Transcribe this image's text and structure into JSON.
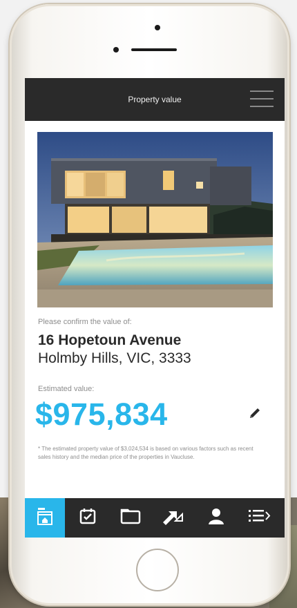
{
  "header": {
    "title": "Property value"
  },
  "hero": {
    "image_desc": "modern-house-with-pool-photo"
  },
  "property": {
    "confirm_prompt": "Please confirm the value of:",
    "street": "16 Hopetoun Avenue",
    "suburb_line": "Holmby Hills, VIC, 3333",
    "estimated_label": "Estimated value:",
    "value": "$975,834",
    "disclaimer": "* The estimated property value of $3,024,534 is based on various factors such as recent sales history and the median price of the properties in Vaucluse."
  },
  "tabs": [
    {
      "icon": "home-icon",
      "active": true
    },
    {
      "icon": "calendar-icon",
      "active": false
    },
    {
      "icon": "folder-icon",
      "active": false
    },
    {
      "icon": "share-arrows-icon",
      "active": false
    },
    {
      "icon": "profile-icon",
      "active": false
    },
    {
      "icon": "menu-list-icon",
      "active": false
    }
  ],
  "colors": {
    "accent": "#29b6ea",
    "bar": "#2a2a2a",
    "text": "#2a2a2a"
  }
}
